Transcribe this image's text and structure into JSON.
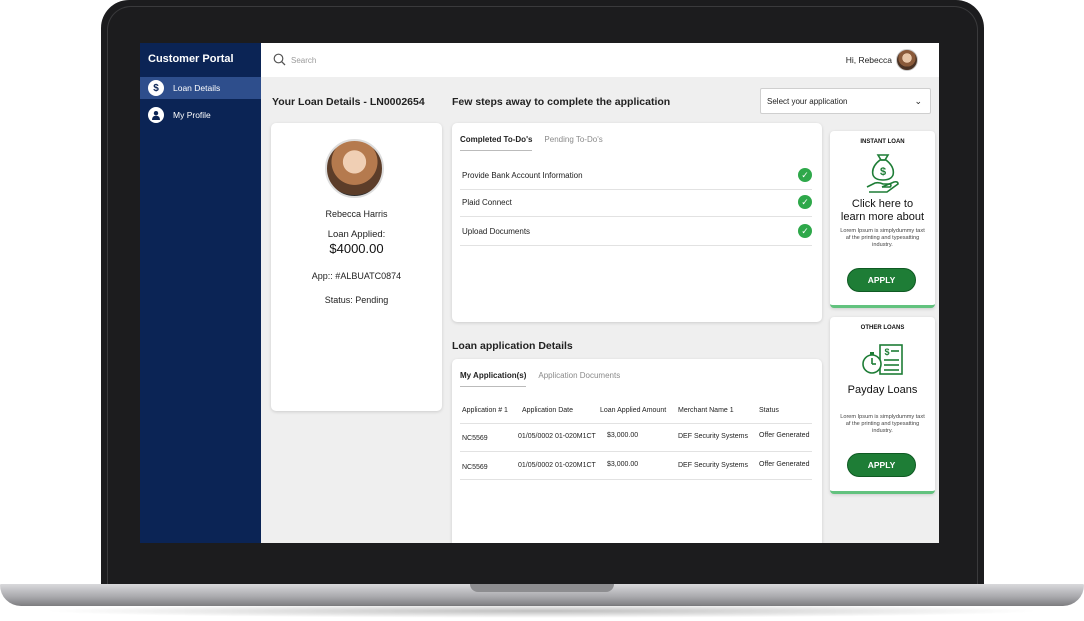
{
  "sidebar": {
    "title": "Customer Portal",
    "items": [
      {
        "label": "Loan Details",
        "icon": "dollar-icon"
      },
      {
        "label": "My Profile",
        "icon": "user-icon"
      }
    ]
  },
  "topbar": {
    "search_placeholder": "Search",
    "greeting": "Hi, Rebecca"
  },
  "headings": {
    "loan_details": "Your Loan Details - LN0002654",
    "steps": "Few steps away to complete the application",
    "app_details": "Loan application Details"
  },
  "select": {
    "selected": "Select your application"
  },
  "profile": {
    "name": "Rebecca Harris",
    "loan_applied_label": "Loan Applied:",
    "loan_amount": "$4000.00",
    "app_number": "App:: #ALBUATC0874",
    "status": "Status: Pending"
  },
  "todos": {
    "tabs": [
      "Completed To-Do's",
      "Pending To-Do's"
    ],
    "items": [
      "Provide Bank Account Information",
      "Plaid Connect",
      "Upload Documents"
    ]
  },
  "applications": {
    "tabs": [
      "My Application(s)",
      "Application Documents"
    ],
    "columns": [
      "Application # 1",
      "Application Date",
      "Loan Applied Amount",
      "Merchant Name 1",
      "Status"
    ],
    "rows": [
      [
        "NC5569",
        "01/05/0002 01-020M1CT",
        "$3,000.00",
        "DEF Security Systems",
        "Offer Generated"
      ],
      [
        "NC5569",
        "01/05/0002 01-020M1CT",
        "$3,000.00",
        "DEF Security Systems",
        "Offer Generated"
      ]
    ]
  },
  "promos": {
    "instant": {
      "tag": "INSTANT LOAN",
      "title_line1": "Click here to",
      "title_line2": "learn more about",
      "desc": "Lorem Ipsum is simplydummy taxt af the printing and typesatting industry.",
      "button": "APPLY"
    },
    "other": {
      "tag": "OTHER LOANS",
      "title": "Payday Loans",
      "desc": "Lorem Ipsum is simplydummy taxt af the printing and typesatting industry.",
      "button": "APPLY"
    }
  },
  "colors": {
    "sidebar": "#0b2455",
    "sidebar_active": "#2e4e8c",
    "accent_green": "#1e7d36",
    "check_green": "#2ea84a"
  }
}
